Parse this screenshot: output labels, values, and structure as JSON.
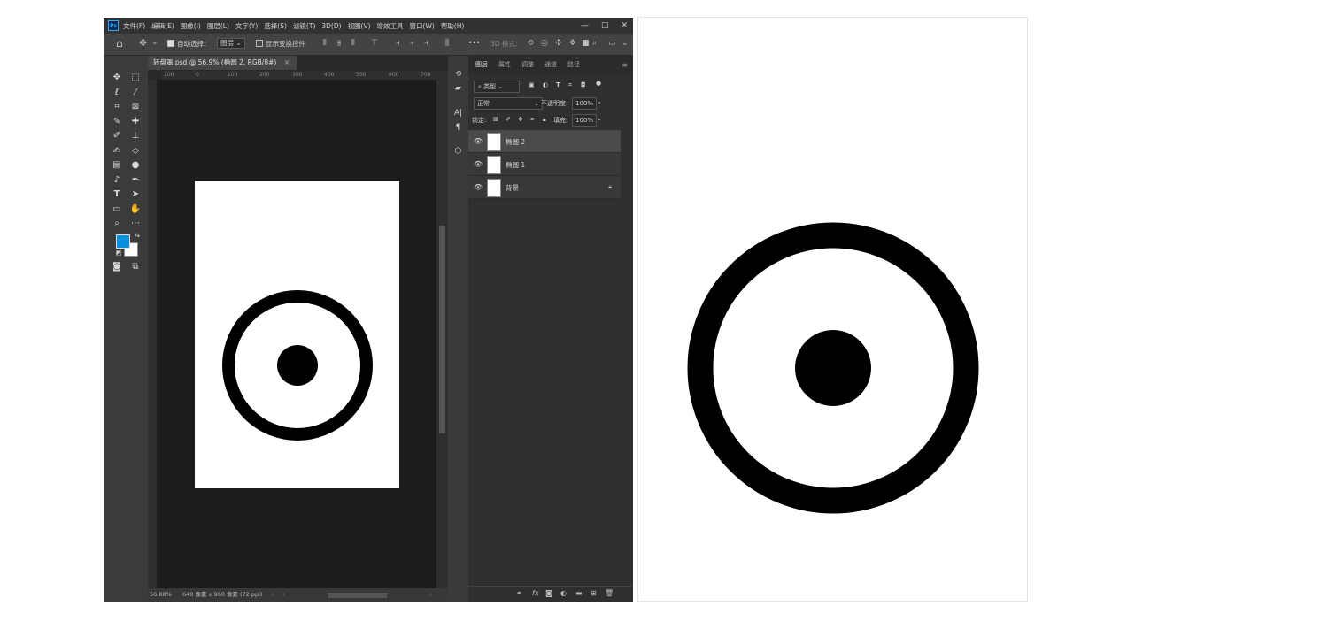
{
  "app": {
    "logo": "Ps"
  },
  "menu": [
    "文件(F)",
    "编辑(E)",
    "图像(I)",
    "图层(L)",
    "文字(Y)",
    "选择(S)",
    "滤镜(T)",
    "3D(D)",
    "视图(V)",
    "增效工具",
    "窗口(W)",
    "帮助(H)"
  ],
  "window_buttons": {
    "minimize": "—",
    "maximize": "□",
    "close": "✕"
  },
  "options": {
    "auto_select_label": "自动选择：",
    "auto_select_value": "图层",
    "show_transform_label": "显示变换控件",
    "mode_3d_label": "3D 模式：",
    "more": "•••"
  },
  "document": {
    "tab_title": "转盘罩.psd @ 56.9% (椭圆 2, RGB/8#)",
    "tab_close": "×",
    "ruler_ticks": [
      "100",
      "0",
      "100",
      "200",
      "300",
      "400",
      "500",
      "600",
      "700"
    ],
    "zoom": "56.88%",
    "doc_info": "640 像素 x 960 像素 (72 ppi)"
  },
  "layers_panel": {
    "tabs": [
      "图层",
      "属性",
      "调整",
      "通道",
      "路径"
    ],
    "filter_label": "类型",
    "blend_mode": "正常",
    "opacity_label": "不透明度:",
    "opacity_value": "100%",
    "lock_label": "锁定:",
    "fill_label": "填充:",
    "fill_value": "100%",
    "layers": [
      {
        "name": "椭圆 2",
        "selected": true,
        "locked": false
      },
      {
        "name": "椭圆 1",
        "selected": false,
        "locked": false
      },
      {
        "name": "背景",
        "selected": false,
        "locked": true
      }
    ]
  },
  "colors": {
    "foreground": "#0a8fdc",
    "background": "#ffffff",
    "ui_dark": "#282828",
    "shape": "#000000"
  },
  "icons": [
    "home-icon",
    "move-icon",
    "marquee-icon",
    "lasso-icon",
    "magic-wand-icon",
    "crop-icon",
    "frame-icon",
    "eyedropper-icon",
    "healing-icon",
    "brush-icon",
    "stamp-icon",
    "history-brush-icon",
    "eraser-icon",
    "gradient-icon",
    "blur-icon",
    "dodge-icon",
    "pen-icon",
    "type-icon",
    "path-select-icon",
    "rectangle-icon",
    "hand-icon",
    "zoom-icon",
    "more-tools-icon",
    "eye-icon",
    "lock-icon",
    "trash-icon",
    "new-layer-icon",
    "folder-icon",
    "fx-icon",
    "mask-icon",
    "link-icon"
  ]
}
